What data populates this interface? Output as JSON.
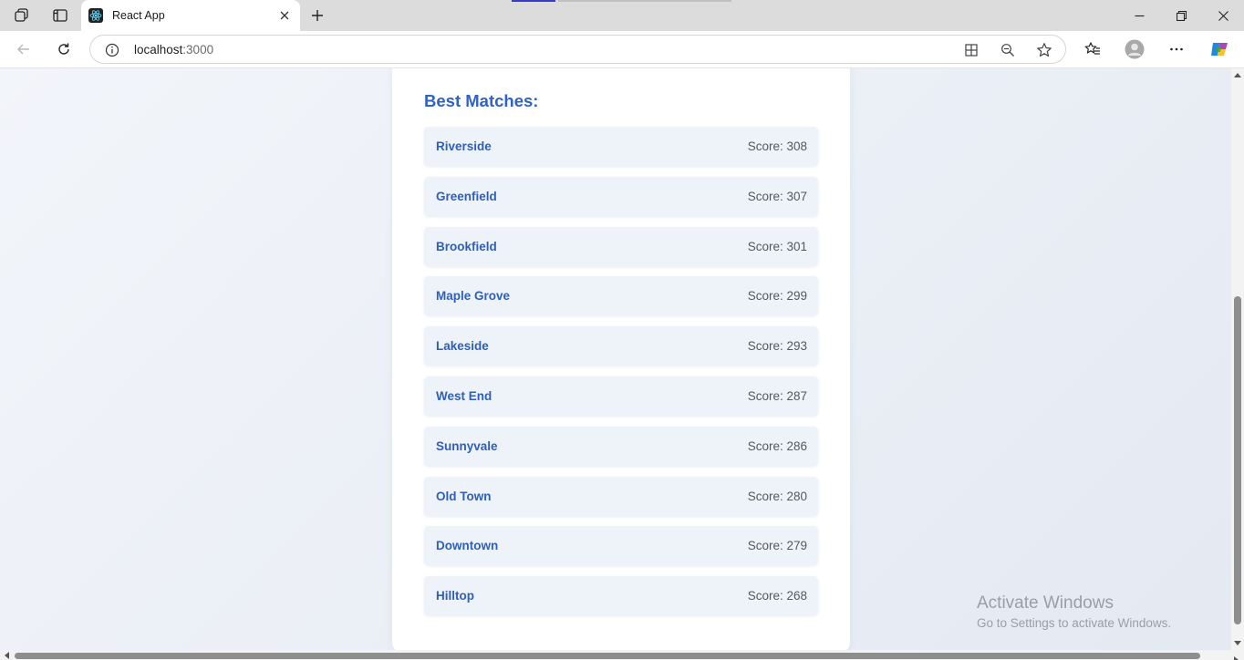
{
  "browser": {
    "tab_title": "React App",
    "url_host": "localhost",
    "url_port": ":3000"
  },
  "page": {
    "heading": "Best Matches:",
    "matches": [
      {
        "name": "Riverside",
        "score": "Score: 308"
      },
      {
        "name": "Greenfield",
        "score": "Score: 307"
      },
      {
        "name": "Brookfield",
        "score": "Score: 301"
      },
      {
        "name": "Maple Grove",
        "score": "Score: 299"
      },
      {
        "name": "Lakeside",
        "score": "Score: 293"
      },
      {
        "name": "West End",
        "score": "Score: 287"
      },
      {
        "name": "Sunnyvale",
        "score": "Score: 286"
      },
      {
        "name": "Old Town",
        "score": "Score: 280"
      },
      {
        "name": "Downtown",
        "score": "Score: 279"
      },
      {
        "name": "Hilltop",
        "score": "Score: 268"
      }
    ]
  },
  "watermark": {
    "title": "Activate Windows",
    "subtitle": "Go to Settings to activate Windows."
  },
  "colors": {
    "accent": "#2f62c7",
    "item_bg": "#eef2f9",
    "page_bg": "#eaeef5"
  }
}
